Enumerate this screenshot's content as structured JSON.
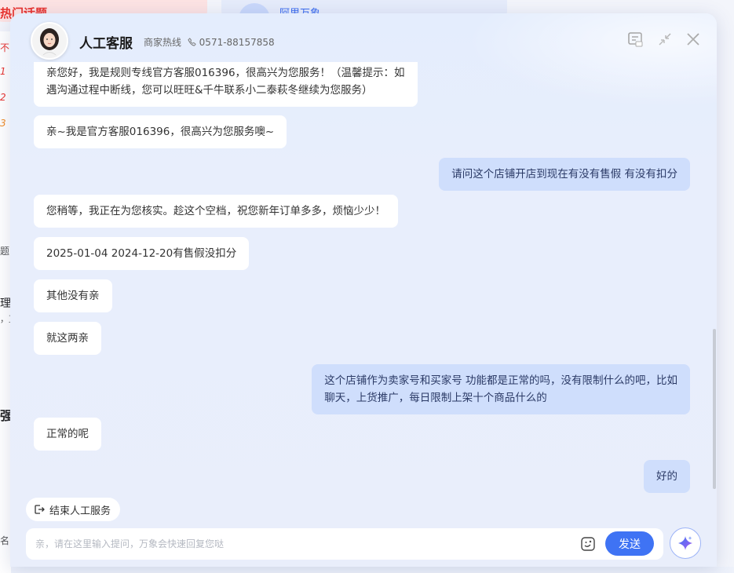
{
  "background": {
    "left_card_title": "热门话题",
    "mid_card_title": "阿里万象",
    "fragments": [
      "不",
      "1",
      "2",
      "3",
      "题",
      "理",
      "，直",
      "强",
      "名"
    ]
  },
  "header": {
    "title": "人工客服",
    "hotline_label": "商家热线",
    "hotline_number": "0571-88157858"
  },
  "messages": [
    {
      "side": "agent",
      "lines": [
        "亲您好，我是规则专线官方客服016396，很高兴为您服务！（温馨提示：如",
        "遇沟通过程中断线，您可以旺旺&千牛联系小二泰萩冬继续为您服务）"
      ]
    },
    {
      "side": "agent",
      "lines": [
        "亲~我是官方客服016396，很高兴为您服务噢~"
      ]
    },
    {
      "side": "user",
      "lines": [
        "请问这个店铺开店到现在有没有售假 有没有扣分"
      ]
    },
    {
      "side": "agent",
      "lines": [
        "您稍等，我正在为您核实。趁这个空档，祝您新年订单多多，烦恼少少！"
      ]
    },
    {
      "side": "agent",
      "lines": [
        "2025-01-04 2024-12-20有售假没扣分"
      ]
    },
    {
      "side": "agent",
      "lines": [
        "其他没有亲"
      ]
    },
    {
      "side": "agent",
      "lines": [
        "就这两亲"
      ]
    },
    {
      "side": "user",
      "lines": [
        "这个店铺作为卖家号和买家号 功能都是正常的吗，没有限制什么的吧，比如",
        "聊天，上货推广，每日限制上架十个商品什么的"
      ]
    },
    {
      "side": "agent",
      "lines": [
        "正常的呢"
      ]
    },
    {
      "side": "user",
      "lines": [
        "好的"
      ]
    }
  ],
  "footer": {
    "end_service_label": "结束人工服务",
    "input_placeholder": "亲，请在这里输入提问，万象会快速回复您哒",
    "send_label": "发送"
  },
  "icons": {
    "feedback": "feedback-icon",
    "minimize": "shrink-icon",
    "close": "close-icon",
    "phone": "phone-icon",
    "exit": "exit-icon",
    "emoji": "emoji-icon",
    "ai": "sparkle-icon"
  },
  "colors": {
    "accent": "#3f73f4",
    "user_bubble": "#cfdefc",
    "agent_bubble": "#ffffff"
  }
}
